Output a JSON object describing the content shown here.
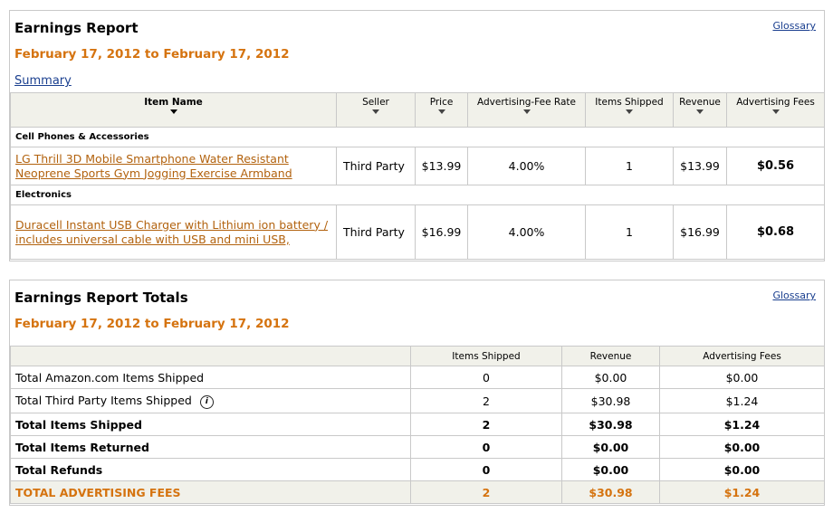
{
  "report": {
    "title": "Earnings Report",
    "glossary": "Glossary",
    "date_range": "February 17, 2012 to February 17, 2012",
    "summary_link": "Summary",
    "columns": [
      "Item Name",
      "Seller",
      "Price",
      "Advertising-Fee Rate",
      "Items Shipped",
      "Revenue",
      "Advertising Fees"
    ],
    "categories": [
      {
        "name": "Cell Phones & Accessories",
        "items": [
          {
            "name": "LG Thrill 3D Mobile Smartphone Water Resistant Neoprene Sports Gym Jogging Exercise Armband",
            "seller": "Third Party",
            "price": "$13.99",
            "rate": "4.00%",
            "shipped": "1",
            "revenue": "$13.99",
            "fees": "$0.56"
          }
        ]
      },
      {
        "name": "Electronics",
        "items": [
          {
            "name": "Duracell Instant USB Charger with Lithium ion battery / includes universal cable with USB and mini USB,",
            "seller": "Third Party",
            "price": "$16.99",
            "rate": "4.00%",
            "shipped": "1",
            "revenue": "$16.99",
            "fees": "$0.68"
          }
        ]
      }
    ]
  },
  "totals": {
    "title": "Earnings Report Totals",
    "glossary": "Glossary",
    "date_range": "February 17, 2012 to February 17, 2012",
    "columns": [
      "",
      "Items Shipped",
      "Revenue",
      "Advertising Fees"
    ],
    "rows": [
      {
        "label": "Total Amazon.com Items Shipped",
        "shipped": "0",
        "revenue": "$0.00",
        "fees": "$0.00"
      },
      {
        "label": "Total Third Party Items Shipped",
        "shipped": "2",
        "revenue": "$30.98",
        "fees": "$1.24"
      },
      {
        "label": "Total Items Shipped",
        "shipped": "2",
        "revenue": "$30.98",
        "fees": "$1.24"
      },
      {
        "label": "Total Items Returned",
        "shipped": "0",
        "revenue": "$0.00",
        "fees": "$0.00"
      },
      {
        "label": "Total Refunds",
        "shipped": "0",
        "revenue": "$0.00",
        "fees": "$0.00"
      },
      {
        "label": "TOTAL ADVERTISING FEES",
        "shipped": "2",
        "revenue": "$30.98",
        "fees": "$1.24"
      }
    ],
    "info_icon": "info-icon"
  },
  "colors": {
    "accent": "#d5730f",
    "link": "#1a3f8f",
    "item_link": "#b2620e",
    "header_bg": "#f1f1ea",
    "border": "#c9c9c9"
  }
}
